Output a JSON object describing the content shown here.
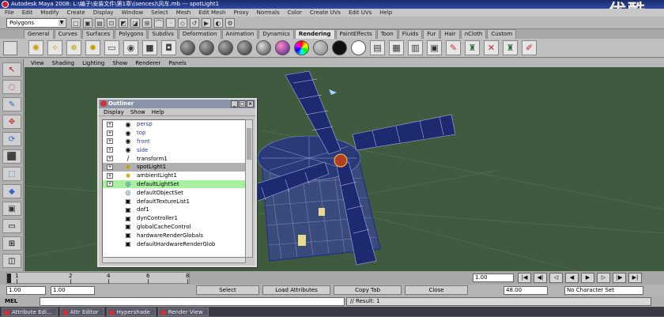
{
  "window": {
    "title": "Autodesk Maya 2008: L:\\编子\\安装文件\\第1章\\(sences)\\风车.mb  ---  spotLight1",
    "watermark": "优酷"
  },
  "menubar": [
    "File",
    "Edit",
    "Modify",
    "Create",
    "Display",
    "Window",
    "Select",
    "Mesh",
    "Edit Mesh",
    "Proxy",
    "Normals",
    "Color",
    "Create UVs",
    "Edit UVs",
    "Help"
  ],
  "status_line": {
    "mode": "Polygons",
    "icons": [
      "new-scene-icon",
      "open-scene-icon",
      "save-scene-icon",
      "select-hierarchy-icon",
      "select-object-icon",
      "select-component-icon",
      "snap-grid-icon",
      "snap-curve-icon",
      "snap-point-icon",
      "snap-plane-icon",
      "history-icon",
      "render-icon",
      "ipr-icon",
      "render-settings-icon"
    ]
  },
  "shelf_tabs": [
    {
      "label": "General",
      "active": false
    },
    {
      "label": "Curves",
      "active": false
    },
    {
      "label": "Surfaces",
      "active": false
    },
    {
      "label": "Polygons",
      "active": false
    },
    {
      "label": "Subdivs",
      "active": false
    },
    {
      "label": "Deformation",
      "active": false
    },
    {
      "label": "Animation",
      "active": false
    },
    {
      "label": "Dynamics",
      "active": false
    },
    {
      "label": "Rendering",
      "active": true
    },
    {
      "label": "PaintEffects",
      "active": false
    },
    {
      "label": "Toon",
      "active": false
    },
    {
      "label": "Fluids",
      "active": false
    },
    {
      "label": "Fur",
      "active": false
    },
    {
      "label": "Hair",
      "active": false
    },
    {
      "label": "nCloth",
      "active": false
    },
    {
      "label": "Custom",
      "active": false
    }
  ],
  "panel_menu": [
    "View",
    "Shading",
    "Lighting",
    "Show",
    "Renderer",
    "Panels"
  ],
  "outliner": {
    "title": "Outliner",
    "menu": [
      "Display",
      "Show",
      "Help"
    ],
    "items": [
      {
        "label": "persp",
        "icon": "camera-icon",
        "expand": "+",
        "kind": "cam"
      },
      {
        "label": "top",
        "icon": "camera-icon",
        "expand": "+",
        "kind": "cam"
      },
      {
        "label": "front",
        "icon": "camera-icon",
        "expand": "+",
        "kind": "cam"
      },
      {
        "label": "side",
        "icon": "camera-icon",
        "expand": "+",
        "kind": "cam"
      },
      {
        "label": "transform1",
        "icon": "curve-icon",
        "expand": "+",
        "kind": ""
      },
      {
        "label": "spotLight1",
        "icon": "spotlight-icon",
        "expand": "+",
        "kind": "sel"
      },
      {
        "label": "ambientLight1",
        "icon": "light-icon",
        "expand": "+",
        "kind": ""
      },
      {
        "label": "defaultLightSet",
        "icon": "set-icon",
        "expand": "+",
        "kind": "hl"
      },
      {
        "label": "defaultObjectSet",
        "icon": "set-icon",
        "expand": "",
        "kind": ""
      },
      {
        "label": "defaultTextureList1",
        "icon": "node-icon",
        "expand": "",
        "kind": ""
      },
      {
        "label": "dof1",
        "icon": "node-icon",
        "expand": "",
        "kind": ""
      },
      {
        "label": "dynController1",
        "icon": "node-icon",
        "expand": "",
        "kind": ""
      },
      {
        "label": "globalCacheControl",
        "icon": "node-icon",
        "expand": "",
        "kind": ""
      },
      {
        "label": "hardwareRenderGlobals",
        "icon": "node-icon",
        "expand": "",
        "kind": ""
      },
      {
        "label": "defaultHardwareRenderGlob",
        "icon": "node-icon",
        "expand": "",
        "kind": ""
      }
    ]
  },
  "time_slider": {
    "ticks": [
      "1",
      "2",
      "4",
      "6",
      "8",
      "1"
    ],
    "current_frame": "1.00"
  },
  "range_slider": {
    "start": "1.00",
    "start2": "1.00",
    "end": "48.00",
    "char_set": "No Character Set"
  },
  "bottom_buttons": {
    "select": "Select",
    "load_attributes": "Load Attributes",
    "copy_tab": "Copy Tab",
    "close": "Close"
  },
  "command_line": {
    "label": "MEL",
    "result": "// Result: 1"
  },
  "taskbar": [
    "Attribute Edi...",
    "Attr Editor",
    "Hypershade",
    "Render View"
  ],
  "colors": {
    "viewport_bg": "#3f5a3f",
    "wireframe": "#1a2a8a",
    "highlight": "#a8f0a0"
  }
}
